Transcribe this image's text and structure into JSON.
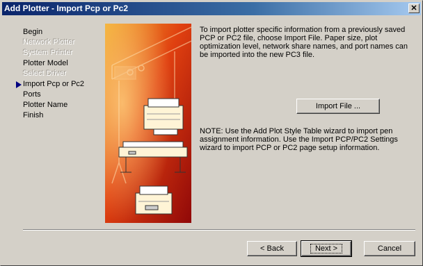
{
  "window": {
    "title": "Add Plotter - Import Pcp or Pc2",
    "close_glyph": "✕"
  },
  "steps": [
    {
      "label": "Begin",
      "state": "normal"
    },
    {
      "label": "Network Plotter",
      "state": "disabled"
    },
    {
      "label": "System Printer",
      "state": "disabled"
    },
    {
      "label": "Plotter Model",
      "state": "normal"
    },
    {
      "label": "Select Driver",
      "state": "disabled"
    },
    {
      "label": "Import Pcp or Pc2",
      "state": "current"
    },
    {
      "label": "Ports",
      "state": "normal"
    },
    {
      "label": "Plotter Name",
      "state": "normal"
    },
    {
      "label": "Finish",
      "state": "normal"
    }
  ],
  "content": {
    "intro": "To import plotter specific information from a previously saved PCP or PC2 file, choose Import File. Paper size, plot optimization level, network share names, and port names can be imported into the new PC3 file.",
    "import_button": "Import File ...",
    "note": "NOTE: Use the Add Plot Style Table wizard to import pen assignment information. Use the Import PCP/PC2 Settings wizard to import PCP or PC2 page setup information."
  },
  "footer": {
    "back": "< Back",
    "next": "Next >",
    "cancel": "Cancel"
  },
  "colors": {
    "title_gradient_start": "#0a246a",
    "title_gradient_end": "#a6caf0",
    "illustration_red": "#c01010",
    "illustration_orange": "#f0a020",
    "current_step_arrow": "#000080"
  },
  "icons": {
    "illustration": "plotter-and-printers-illustration",
    "current_step": "right-triangle-arrow-icon"
  }
}
